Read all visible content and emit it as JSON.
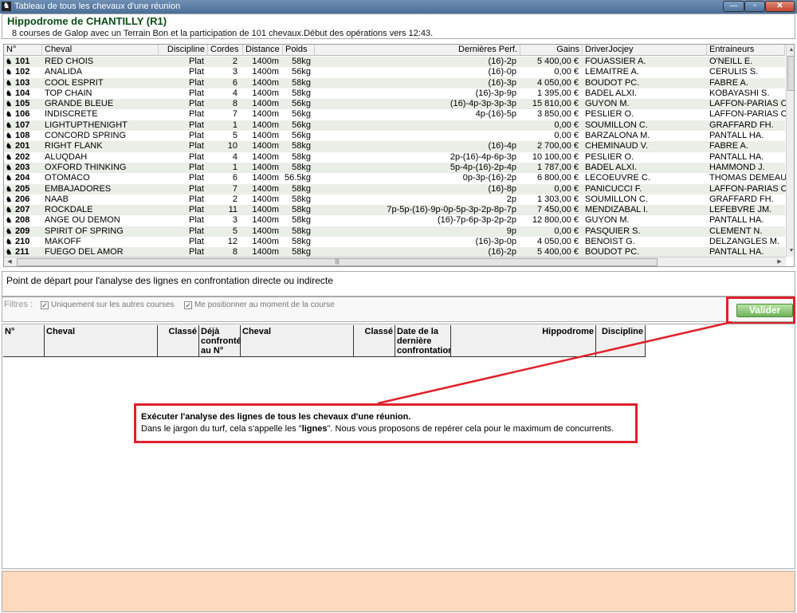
{
  "window": {
    "title": "Tableau de tous les chevaux d'une réunion",
    "app_icon": "horse-app-icon"
  },
  "header": {
    "title": "Hippodrome de  CHANTILLY (R1)",
    "subtitle": "8 courses de Galop avec un Terrain Bon et la participation de 101 chevaux.Début des opérations vers 12:43."
  },
  "table": {
    "columns": [
      "N°",
      "Cheval",
      "Discipline",
      "Cordes",
      "Distance",
      "Poids",
      "Dernières Perf.",
      "Gains",
      "DriverJocjey",
      "Entraineurs"
    ],
    "rows": [
      {
        "num": "101",
        "cheval": "RED CHOIS",
        "discipline": "Plat",
        "cordes": "2",
        "distance": "1400m",
        "poids": "58kg",
        "perf": "(16)-2p",
        "gains": "5 400,00 €",
        "driver": "FOUASSIER A.",
        "entraineur": "O'NEILL E."
      },
      {
        "num": "102",
        "cheval": "ANALIDA",
        "discipline": "Plat",
        "cordes": "3",
        "distance": "1400m",
        "poids": "56kg",
        "perf": "(16)-0p",
        "gains": "0,00 €",
        "driver": "LEMAITRE A.",
        "entraineur": "CERULIS S."
      },
      {
        "num": "103",
        "cheval": "COOL ESPRIT",
        "discipline": "Plat",
        "cordes": "6",
        "distance": "1400m",
        "poids": "58kg",
        "perf": "(16)-3p",
        "gains": "4 050,00 €",
        "driver": "BOUDOT PC.",
        "entraineur": "FABRE A."
      },
      {
        "num": "104",
        "cheval": "TOP CHAIN",
        "discipline": "Plat",
        "cordes": "4",
        "distance": "1400m",
        "poids": "58kg",
        "perf": "(16)-3p-9p",
        "gains": "1 395,00 €",
        "driver": "BADEL ALXI.",
        "entraineur": "KOBAYASHI S."
      },
      {
        "num": "105",
        "cheval": "GRANDE BLEUE",
        "discipline": "Plat",
        "cordes": "8",
        "distance": "1400m",
        "poids": "56kg",
        "perf": "(16)-4p-3p-3p-3p",
        "gains": "15 810,00 €",
        "driver": "GUYON M.",
        "entraineur": "LAFFON-PARIAS C."
      },
      {
        "num": "106",
        "cheval": "INDISCRETE",
        "discipline": "Plat",
        "cordes": "7",
        "distance": "1400m",
        "poids": "56kg",
        "perf": "4p-(16)-5p",
        "gains": "3 850,00 €",
        "driver": "PESLIER O.",
        "entraineur": "LAFFON-PARIAS C."
      },
      {
        "num": "107",
        "cheval": "LIGHTUPTHENIGHT",
        "discipline": "Plat",
        "cordes": "1",
        "distance": "1400m",
        "poids": "56kg",
        "perf": "",
        "gains": "0,00 €",
        "driver": "SOUMILLON C.",
        "entraineur": "GRAFFARD FH."
      },
      {
        "num": "108",
        "cheval": "CONCORD SPRING",
        "discipline": "Plat",
        "cordes": "5",
        "distance": "1400m",
        "poids": "56kg",
        "perf": "",
        "gains": "0,00 €",
        "driver": "BARZALONA M.",
        "entraineur": "PANTALL HA."
      },
      {
        "num": "201",
        "cheval": "RIGHT FLANK",
        "discipline": "Plat",
        "cordes": "10",
        "distance": "1400m",
        "poids": "58kg",
        "perf": "(16)-4p",
        "gains": "2 700,00 €",
        "driver": "CHEMINAUD V.",
        "entraineur": "FABRE A."
      },
      {
        "num": "202",
        "cheval": "ALUQDAH",
        "discipline": "Plat",
        "cordes": "4",
        "distance": "1400m",
        "poids": "58kg",
        "perf": "2p-(16)-4p-6p-3p",
        "gains": "10 100,00 €",
        "driver": "PESLIER O.",
        "entraineur": "PANTALL HA."
      },
      {
        "num": "203",
        "cheval": "OXFORD THINKING",
        "discipline": "Plat",
        "cordes": "1",
        "distance": "1400m",
        "poids": "58kg",
        "perf": "5p-4p-(16)-2p-4p",
        "gains": "1 787,00 €",
        "driver": "BADEL ALXI.",
        "entraineur": "HAMMOND J."
      },
      {
        "num": "204",
        "cheval": "OTOMACO",
        "discipline": "Plat",
        "cordes": "6",
        "distance": "1400m",
        "poids": "56.5kg",
        "perf": "0p-3p-(16)-2p",
        "gains": "6 800,00 €",
        "driver": "LECOEUVRE C.",
        "entraineur": "THOMAS DEMEAULT"
      },
      {
        "num": "205",
        "cheval": "EMBAJADORES",
        "discipline": "Plat",
        "cordes": "7",
        "distance": "1400m",
        "poids": "58kg",
        "perf": "(16)-8p",
        "gains": "0,00 €",
        "driver": "PANICUCCI F.",
        "entraineur": "LAFFON-PARIAS C."
      },
      {
        "num": "206",
        "cheval": "NAAB",
        "discipline": "Plat",
        "cordes": "2",
        "distance": "1400m",
        "poids": "58kg",
        "perf": "2p",
        "gains": "1 303,00 €",
        "driver": "SOUMILLON C.",
        "entraineur": "GRAFFARD FH."
      },
      {
        "num": "207",
        "cheval": "ROCKDALE",
        "discipline": "Plat",
        "cordes": "11",
        "distance": "1400m",
        "poids": "58kg",
        "perf": "7p-5p-(16)-9p-0p-5p-3p-2p-8p-7p",
        "gains": "7 450,00 €",
        "driver": "MENDIZABAL I.",
        "entraineur": "LEFEBVRE JM."
      },
      {
        "num": "208",
        "cheval": "ANGE OU DEMON",
        "discipline": "Plat",
        "cordes": "3",
        "distance": "1400m",
        "poids": "58kg",
        "perf": "(16)-7p-6p-3p-2p-2p",
        "gains": "12 800,00 €",
        "driver": "GUYON M.",
        "entraineur": "PANTALL HA."
      },
      {
        "num": "209",
        "cheval": "SPIRIT OF SPRING",
        "discipline": "Plat",
        "cordes": "5",
        "distance": "1400m",
        "poids": "58kg",
        "perf": "9p",
        "gains": "0,00 €",
        "driver": "PASQUIER S.",
        "entraineur": "CLEMENT N."
      },
      {
        "num": "210",
        "cheval": "MAKOFF",
        "discipline": "Plat",
        "cordes": "12",
        "distance": "1400m",
        "poids": "58kg",
        "perf": "(16)-3p-0p",
        "gains": "4 050,00 €",
        "driver": "BENOIST G.",
        "entraineur": "DELZANGLES M."
      },
      {
        "num": "211",
        "cheval": "FUEGO DEL AMOR",
        "discipline": "Plat",
        "cordes": "8",
        "distance": "1400m",
        "poids": "58kg",
        "perf": "(16)-2p",
        "gains": "5 400,00 €",
        "driver": "BOUDOT PC.",
        "entraineur": "PANTALL HA."
      }
    ]
  },
  "analysis": {
    "label": "Point de départ pour l'analyse des lignes en confrontation directe ou indirecte",
    "filters_label": "Filtres :",
    "filter1": "Uniquement sur les autres courses",
    "filter2": "Me positionner au moment de la course",
    "valider_label": "Valider",
    "highlight_color": "#e0202a",
    "valider_color": "#70b35a"
  },
  "bottom_table": {
    "columns": {
      "num": "N°",
      "cheval": "Cheval",
      "classe1": "Classé",
      "deja": "Déjà confronté au N°",
      "cheval2": "Cheval",
      "classe2": "Classé",
      "date": "Date de la dernière confrontation",
      "hippodrome": "Hippodrome",
      "discipline": "Discipline"
    }
  },
  "callout": {
    "title": "Exécuter l'analyse des lignes de tous les chevaux d'une réunion.",
    "body_before": "Dans le jargon du turf, cela s'appelle les \"",
    "body_bold": "lignes",
    "body_after": "\". Nous vous proposons de repérer cela pour le maximum de concurrents."
  },
  "footer": {
    "color": "#fdd9bd"
  }
}
